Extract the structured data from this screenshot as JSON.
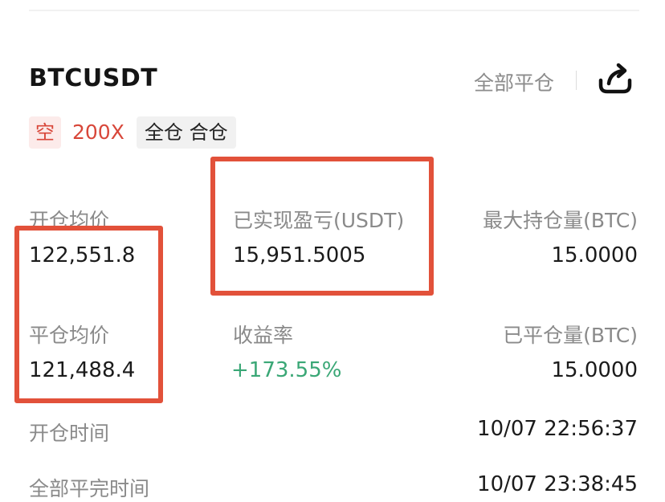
{
  "position": {
    "symbol": "BTCUSDT",
    "close_all_label": "全部平仓",
    "share_icon": "share-icon",
    "side_tag": "空",
    "leverage": "200X",
    "margin_mode": "全仓 合仓"
  },
  "stats": {
    "open_avg_price": {
      "label": "开仓均价",
      "value": "122,551.8"
    },
    "realized_pnl": {
      "label": "已实现盈亏(USDT)",
      "value": "15,951.5005"
    },
    "max_position": {
      "label": "最大持仓量(BTC)",
      "value": "15.0000"
    },
    "close_avg_price": {
      "label": "平仓均价",
      "value": "121,488.4"
    },
    "roi": {
      "label": "收益率",
      "value": "+173.55%"
    },
    "closed_volume": {
      "label": "已平仓量(BTC)",
      "value": "15.0000"
    },
    "open_time": {
      "label": "开仓时间",
      "value": "10/07 22:56:37"
    },
    "close_time": {
      "label": "全部平完时间",
      "value": "10/07 23:38:45"
    }
  },
  "colors": {
    "short_red": "#d8473a",
    "profit_green": "#3aa776",
    "highlight_box": "#e2513a"
  }
}
